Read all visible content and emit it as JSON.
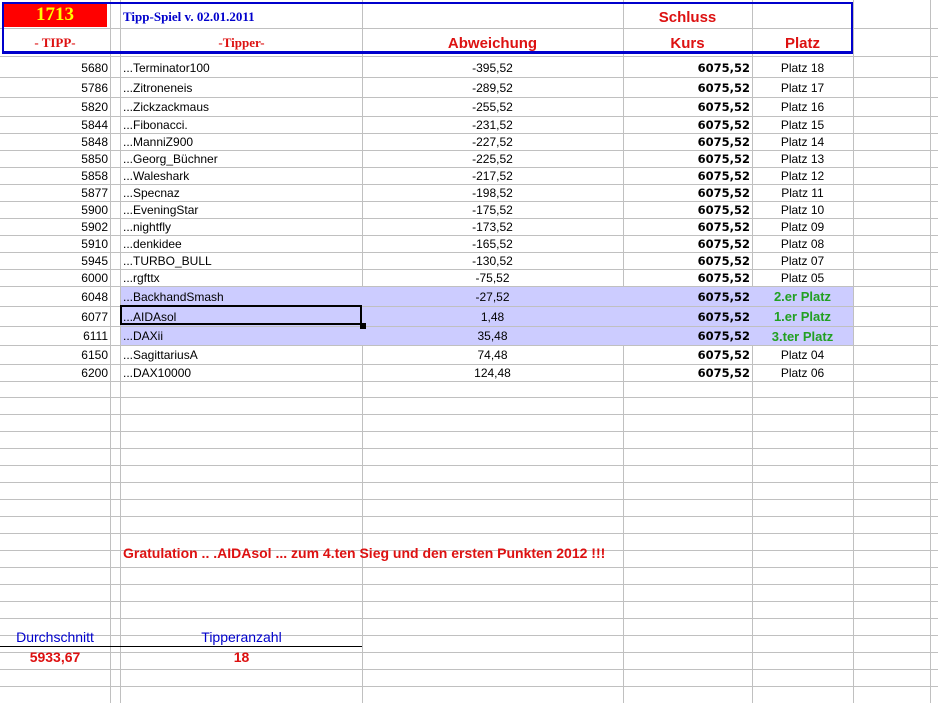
{
  "header": {
    "counter": "1713",
    "title": "Tipp-Spiel v. 02.01.2011",
    "col_tipp": "- TIPP-",
    "col_tipper": "-Tipper-",
    "col_abweichung": "Abweichung",
    "col_schluss": "Schluss",
    "col_kurs": "Kurs",
    "col_platz": "Platz"
  },
  "rows": [
    {
      "tipp": "5680",
      "name": "...Terminator100",
      "abw": "-395,52",
      "kurs": "6075,52",
      "platz": "Platz 18"
    },
    {
      "tipp": "5786",
      "name": "...Zitroneneis",
      "abw": "-289,52",
      "kurs": "6075,52",
      "platz": "Platz 17"
    },
    {
      "tipp": "5820",
      "name": "...Zickzackmaus",
      "abw": "-255,52",
      "kurs": "6075,52",
      "platz": "Platz 16"
    },
    {
      "tipp": "5844",
      "name": "...Fibonacci.",
      "abw": "-231,52",
      "kurs": "6075,52",
      "platz": "Platz 15"
    },
    {
      "tipp": "5848",
      "name": "...ManniZ900",
      "abw": "-227,52",
      "kurs": "6075,52",
      "platz": "Platz 14"
    },
    {
      "tipp": "5850",
      "name": "...Georg_Büchner",
      "abw": "-225,52",
      "kurs": "6075,52",
      "platz": "Platz 13"
    },
    {
      "tipp": "5858",
      "name": "...Waleshark",
      "abw": "-217,52",
      "kurs": "6075,52",
      "platz": "Platz 12"
    },
    {
      "tipp": "5877",
      "name": "...Specnaz",
      "abw": "-198,52",
      "kurs": "6075,52",
      "platz": "Platz 11"
    },
    {
      "tipp": "5900",
      "name": "...EveningStar",
      "abw": "-175,52",
      "kurs": "6075,52",
      "platz": "Platz 10"
    },
    {
      "tipp": "5902",
      "name": "...nightfly",
      "abw": "-173,52",
      "kurs": "6075,52",
      "platz": "Platz 09"
    },
    {
      "tipp": "5910",
      "name": "...denkidee",
      "abw": "-165,52",
      "kurs": "6075,52",
      "platz": "Platz 08"
    },
    {
      "tipp": "5945",
      "name": "...TURBO_BULL",
      "abw": "-130,52",
      "kurs": "6075,52",
      "platz": "Platz 07"
    },
    {
      "tipp": "6000",
      "name": "...rgfttx",
      "abw": "-75,52",
      "kurs": "6075,52",
      "platz": "Platz 05"
    },
    {
      "tipp": "6048",
      "name": "...BackhandSmash",
      "abw": "-27,52",
      "kurs": "6075,52",
      "platz": "2.er Platz",
      "winner": true
    },
    {
      "tipp": "6077",
      "name": "...AIDAsol",
      "abw": "1,48",
      "kurs": "6075,52",
      "platz": "1.er Platz",
      "winner": true
    },
    {
      "tipp": "6111",
      "name": "...DAXii",
      "abw": "35,48",
      "kurs": "6075,52",
      "platz": "3.ter Platz",
      "winner": true
    },
    {
      "tipp": "6150",
      "name": "...SagittariusA",
      "abw": "74,48",
      "kurs": "6075,52",
      "platz": "Platz 04"
    },
    {
      "tipp": "6200",
      "name": "...DAX10000",
      "abw": "124,48",
      "kurs": "6075,52",
      "platz": "Platz 06"
    }
  ],
  "message": "Gratulation .. .AIDAsol ...  zum 4.ten Sieg und den ersten Punkten 2012 !!!",
  "footer": {
    "avg_label": "Durchschnitt",
    "avg_value": "5933,67",
    "count_label": "Tipperanzahl",
    "count_value": "18"
  },
  "colors": {
    "winner": "#22a022",
    "header_red": "#dd1111",
    "title_blue": "#0000cc",
    "highlight": "#ccccff"
  }
}
